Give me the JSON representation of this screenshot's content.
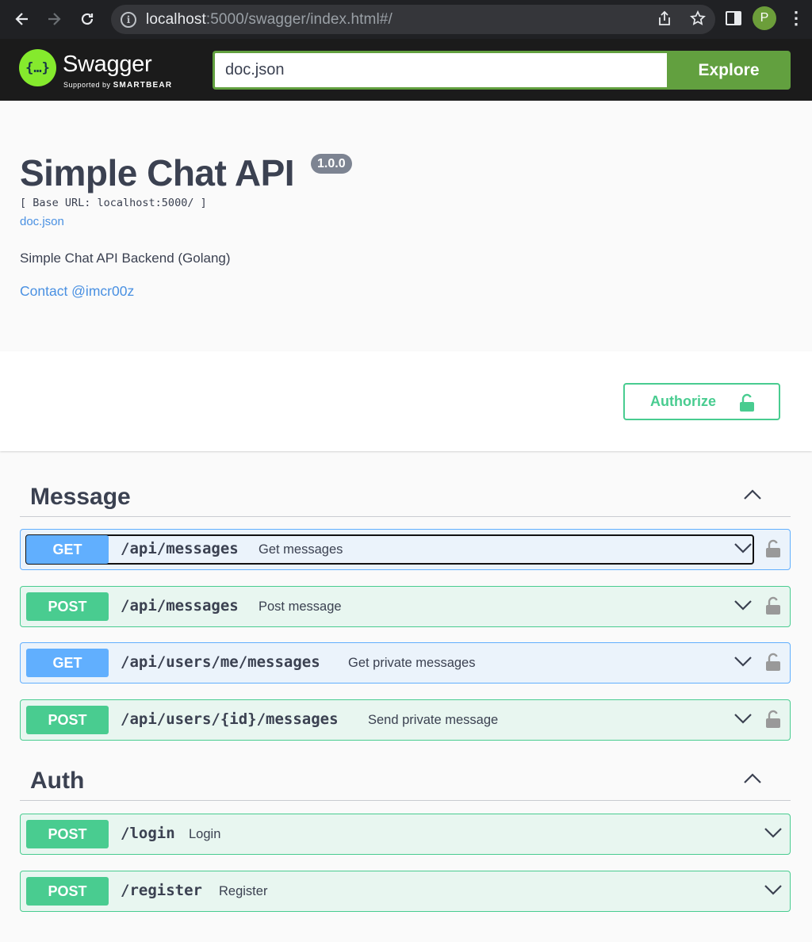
{
  "browser": {
    "url_host": "localhost",
    "url_rest": ":5000/swagger/index.html#/",
    "avatar_letter": "P"
  },
  "topbar": {
    "logo_name": "Swagger",
    "logo_tagline_prefix": "Supported by",
    "logo_tagline_brand": "SMARTBEAR",
    "spec_url_value": "doc.json",
    "explore_label": "Explore"
  },
  "info": {
    "title": "Simple Chat API",
    "version": "1.0.0",
    "base_url": "[ Base URL: localhost:5000/ ]",
    "spec_link": "doc.json",
    "description": "Simple Chat API Backend (Golang)",
    "contact": "Contact @imcr00z"
  },
  "scheme": {
    "authorize_label": "Authorize"
  },
  "tags": [
    {
      "name": "Message",
      "operations": [
        {
          "method": "GET",
          "path": "/api/messages",
          "summary": "Get messages",
          "locked": true
        },
        {
          "method": "POST",
          "path": "/api/messages",
          "summary": "Post message",
          "locked": true
        },
        {
          "method": "GET",
          "path": "/api/users/me/messages",
          "summary": "Get private messages",
          "locked": true
        },
        {
          "method": "POST",
          "path": "/api/users/{id}/messages",
          "summary": "Send private message",
          "locked": true
        }
      ]
    },
    {
      "name": "Auth",
      "operations": [
        {
          "method": "POST",
          "path": "/login",
          "summary": "Login",
          "locked": false
        },
        {
          "method": "POST",
          "path": "/register",
          "summary": "Register",
          "locked": false
        }
      ]
    }
  ],
  "colors": {
    "get": "#61affe",
    "post": "#49cc90",
    "explore": "#62a03f",
    "link": "#4990e2"
  }
}
